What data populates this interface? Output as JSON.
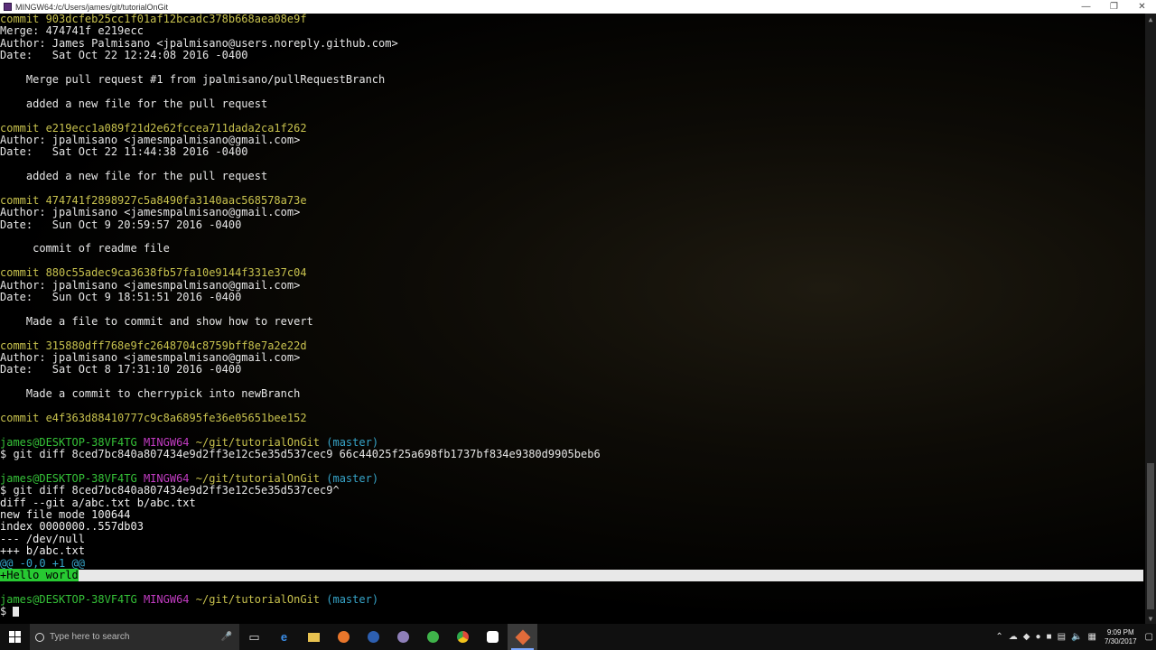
{
  "window": {
    "title": "MINGW64:/c/Users/james/git/tutorialOnGit",
    "minimize": "—",
    "maximize": "❐",
    "close": "✕"
  },
  "terminal": {
    "lines": [
      [
        {
          "t": "commit 903dcfeb25cc1f01af12bcadc378b668aea08e9f",
          "c": "yellow"
        }
      ],
      [
        {
          "t": "Merge: 474741f e219ecc",
          "c": ""
        }
      ],
      [
        {
          "t": "Author: James Palmisano <jpalmisano@users.noreply.github.com>",
          "c": ""
        }
      ],
      [
        {
          "t": "Date:   Sat Oct 22 12:24:08 2016 -0400",
          "c": ""
        }
      ],
      [
        {
          "t": "",
          "c": ""
        }
      ],
      [
        {
          "t": "    Merge pull request #1 from jpalmisano/pullRequestBranch",
          "c": ""
        }
      ],
      [
        {
          "t": "",
          "c": ""
        }
      ],
      [
        {
          "t": "    added a new file for the pull request",
          "c": ""
        }
      ],
      [
        {
          "t": "",
          "c": ""
        }
      ],
      [
        {
          "t": "commit e219ecc1a089f21d2e62fccea711dada2ca1f262",
          "c": "yellow"
        }
      ],
      [
        {
          "t": "Author: jpalmisano <jamesmpalmisano@gmail.com>",
          "c": ""
        }
      ],
      [
        {
          "t": "Date:   Sat Oct 22 11:44:38 2016 -0400",
          "c": ""
        }
      ],
      [
        {
          "t": "",
          "c": ""
        }
      ],
      [
        {
          "t": "    added a new file for the pull request",
          "c": ""
        }
      ],
      [
        {
          "t": "",
          "c": ""
        }
      ],
      [
        {
          "t": "commit 474741f2898927c5a8490fa3140aac568578a73e",
          "c": "yellow"
        }
      ],
      [
        {
          "t": "Author: jpalmisano <jamesmpalmisano@gmail.com>",
          "c": ""
        }
      ],
      [
        {
          "t": "Date:   Sun Oct 9 20:59:57 2016 -0400",
          "c": ""
        }
      ],
      [
        {
          "t": "",
          "c": ""
        }
      ],
      [
        {
          "t": "     commit of readme file",
          "c": ""
        }
      ],
      [
        {
          "t": "",
          "c": ""
        }
      ],
      [
        {
          "t": "commit 880c55adec9ca3638fb57fa10e9144f331e37c04",
          "c": "yellow"
        }
      ],
      [
        {
          "t": "Author: jpalmisano <jamesmpalmisano@gmail.com>",
          "c": ""
        }
      ],
      [
        {
          "t": "Date:   Sun Oct 9 18:51:51 2016 -0400",
          "c": ""
        }
      ],
      [
        {
          "t": "",
          "c": ""
        }
      ],
      [
        {
          "t": "    Made a file to commit and show how to revert",
          "c": ""
        }
      ],
      [
        {
          "t": "",
          "c": ""
        }
      ],
      [
        {
          "t": "commit 315880dff768e9fc2648704c8759bff8e7a2e22d",
          "c": "yellow"
        }
      ],
      [
        {
          "t": "Author: jpalmisano <jamesmpalmisano@gmail.com>",
          "c": ""
        }
      ],
      [
        {
          "t": "Date:   Sat Oct 8 17:31:10 2016 -0400",
          "c": ""
        }
      ],
      [
        {
          "t": "",
          "c": ""
        }
      ],
      [
        {
          "t": "    Made a commit to cherrypick into newBranch",
          "c": ""
        }
      ],
      [
        {
          "t": "",
          "c": ""
        }
      ],
      [
        {
          "t": "commit e4f363d88410777c9c8a6895fe36e05651bee152",
          "c": "yellow"
        }
      ],
      [
        {
          "t": "",
          "c": ""
        }
      ],
      [
        {
          "t": "james@DESKTOP-38VF4TG ",
          "c": "green"
        },
        {
          "t": "MINGW64 ",
          "c": "magenta"
        },
        {
          "t": "~/git/tutorialOnGit ",
          "c": "yellow"
        },
        {
          "t": "(master)",
          "c": "cyan"
        }
      ],
      [
        {
          "t": "$ git diff 8ced7bc840a807434e9d2ff3e12c5e35d537cec9 66c44025f25a698fb1737bf834e9380d9905beb6",
          "c": ""
        }
      ],
      [
        {
          "t": "",
          "c": ""
        }
      ],
      [
        {
          "t": "james@DESKTOP-38VF4TG ",
          "c": "green"
        },
        {
          "t": "MINGW64 ",
          "c": "magenta"
        },
        {
          "t": "~/git/tutorialOnGit ",
          "c": "yellow"
        },
        {
          "t": "(master)",
          "c": "cyan"
        }
      ],
      [
        {
          "t": "$ git diff 8ced7bc840a807434e9d2ff3e12c5e35d537cec9^",
          "c": ""
        }
      ],
      [
        {
          "t": "diff --git a/abc.txt b/abc.txt",
          "c": "white"
        }
      ],
      [
        {
          "t": "new file mode 100644",
          "c": "white"
        }
      ],
      [
        {
          "t": "index 0000000..557db03",
          "c": "white"
        }
      ],
      [
        {
          "t": "--- /dev/null",
          "c": "white"
        }
      ],
      [
        {
          "t": "+++ b/abc.txt",
          "c": "white"
        }
      ],
      [
        {
          "t": "@@ -0,0 +1 @@",
          "c": "cyan"
        }
      ],
      [
        {
          "t": "+Hello world",
          "c": "hl-green"
        }
      ],
      [
        {
          "t": "",
          "c": ""
        }
      ],
      [
        {
          "t": "james@DESKTOP-38VF4TG ",
          "c": "green"
        },
        {
          "t": "MINGW64 ",
          "c": "magenta"
        },
        {
          "t": "~/git/tutorialOnGit ",
          "c": "yellow"
        },
        {
          "t": "(master)",
          "c": "cyan"
        }
      ],
      [
        {
          "t": "$ ",
          "c": ""
        }
      ]
    ],
    "highlight_line": 46,
    "cursor_line": 49
  },
  "taskbar": {
    "search_placeholder": "Type here to search",
    "time": "9:09 PM",
    "date": "7/30/2017",
    "apps": [
      "task-view-icon",
      "edge-icon",
      "file-explorer-icon",
      "firefox-icon",
      "app-icon",
      "app-icon",
      "app-icon",
      "chrome-icon",
      "app-icon",
      "git-bash-icon"
    ]
  }
}
